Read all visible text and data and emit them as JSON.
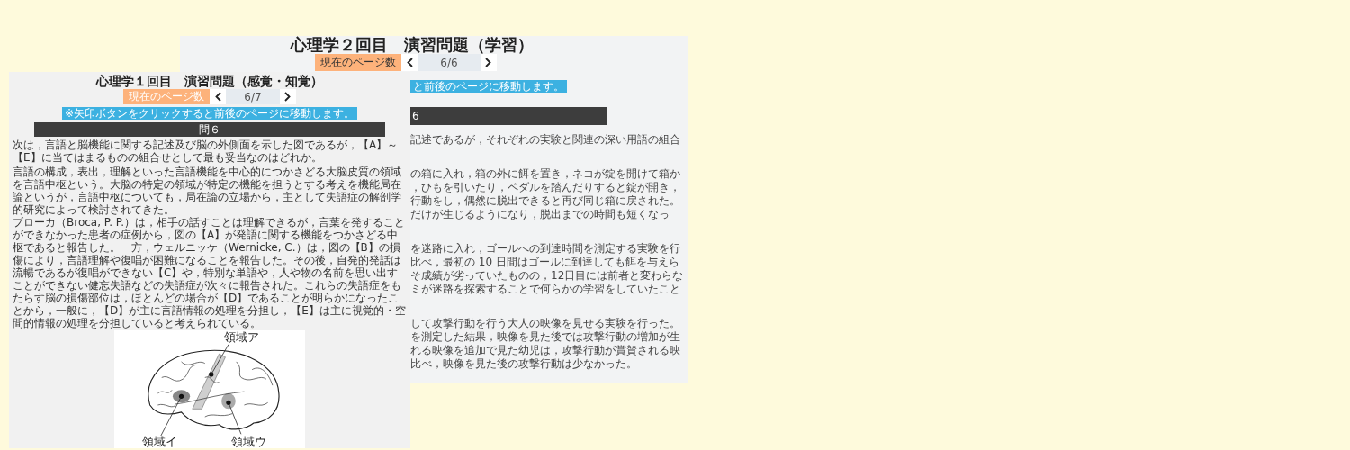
{
  "back_page": {
    "title": "心理学２回目　演習問題（学習）",
    "page_button": "現在のページ数",
    "page_indicator": "6/6",
    "note": "と前後のページに移動します。",
    "question_header": "6",
    "paragraphs": [
      [
        "記述であるが，それぞれの実験と関連の深い用語の組合"
      ],
      [
        "の箱に入れ，箱の外に餌を置き，ネコが錠を開けて箱か",
        "，ひもを引いたり，ペダルを踏んだりすると錠が開き，",
        "行動をし，偶然に脱出できると再び同じ箱に戻された。",
        "だけが生じるようになり，脱出までの時間も短くなっ"
      ],
      [
        "を迷路に入れ，ゴールへの到達時間を測定する実験を行",
        "比べ，最初の 10 日間はゴールに到達しても餌を与えら",
        "そ成績が劣っていたものの，12日目には前者と変わらな",
        "ミが迷路を探索することで何らかの学習をしていたこと"
      ],
      [
        "して攻撃行動を行う大人の映像を見せる実験を行った。",
        "を測定した結果，映像を見た後では攻撃行動の増加が生",
        "れる映像を追加で見た幼児は，攻撃行動が賞賛される映",
        "比べ，映像を見た後の攻撃行動は少なかった。"
      ]
    ]
  },
  "front_page": {
    "title": "心理学１回目　演習問題（感覚・知覚）",
    "page_button": "現在のページ数",
    "page_indicator": "6/7",
    "note": "※矢印ボタンをクリックすると前後のページに移動します。",
    "question_header": "問６",
    "question": "次は，言語と脳機能に関する記述及び脳の外側面を示した図であるが，【A】～【E】に当てはまるものの組合せとして最も妥当なのはどれか。",
    "passage": [
      "言語の構成，表出，理解といった言語機能を中心的につかさどる大脳皮質の領域を言語中枢という。大脳の特定の領域が特定の機能を担うとする考えを機能局在論というが，言語中枢についても，局在論の立場から，主として失語症の解剖学的研究によって検討されてきた。",
      "ブローカ（Broca, P. P.）は，相手の話すことは理解できるが，言葉を発することができなかった患者の症例から，図の【A】が発語に関する機能をつかさどる中枢であると報告した。一方，ウェルニッケ（Wernicke, C.）は，図の【B】の損傷により，言語理解や復唱が困難になることを報告した。その後，自発的発話は流暢であるが復唱ができない【C】や，特別な単語や，人や物の名前を思い出すことができない健忘失語などの失語症が次々に報告された。これらの失語症をもたらす脳の損傷部位は，ほとんどの場合が【D】であることが明らかになったことから，一般に，【D】が主に言語情報の処理を分担し，【E】は主に視覚的・空間的情報の処理を分担していると考えられている。"
    ],
    "figure": {
      "labels": [
        "領域ア",
        "領域イ",
        "領域ウ"
      ]
    }
  }
}
